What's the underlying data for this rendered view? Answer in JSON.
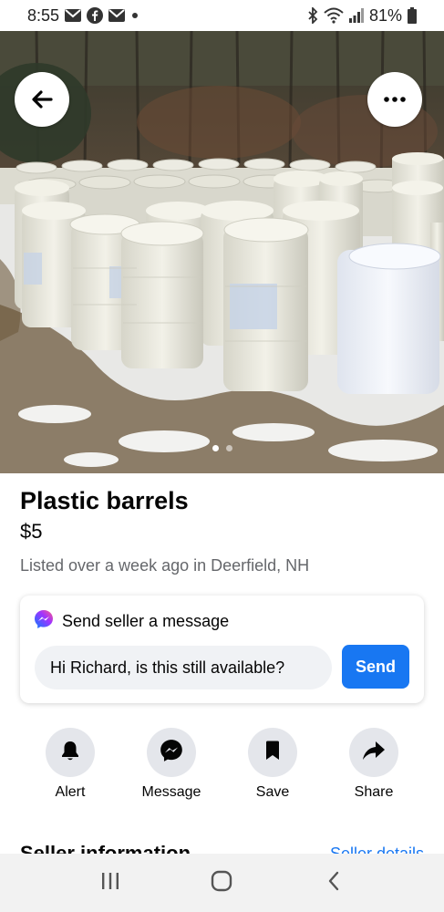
{
  "status_bar": {
    "time": "8:55",
    "battery": "81%"
  },
  "listing": {
    "title": "Plastic barrels",
    "price": "$5",
    "meta": "Listed over a week ago in Deerfield, NH"
  },
  "message_card": {
    "heading": "Send seller a message",
    "input_value": "Hi Richard, is this still available?",
    "send_label": "Send"
  },
  "actions": {
    "alert": "Alert",
    "message": "Message",
    "save": "Save",
    "share": "Share"
  },
  "seller": {
    "title": "Seller information",
    "link": "Seller details"
  },
  "photo": {
    "page_count": 2,
    "current_page": 1
  },
  "colors": {
    "accent": "#1877f2",
    "secondary_text": "#65676b",
    "action_bg": "#e4e6eb"
  }
}
